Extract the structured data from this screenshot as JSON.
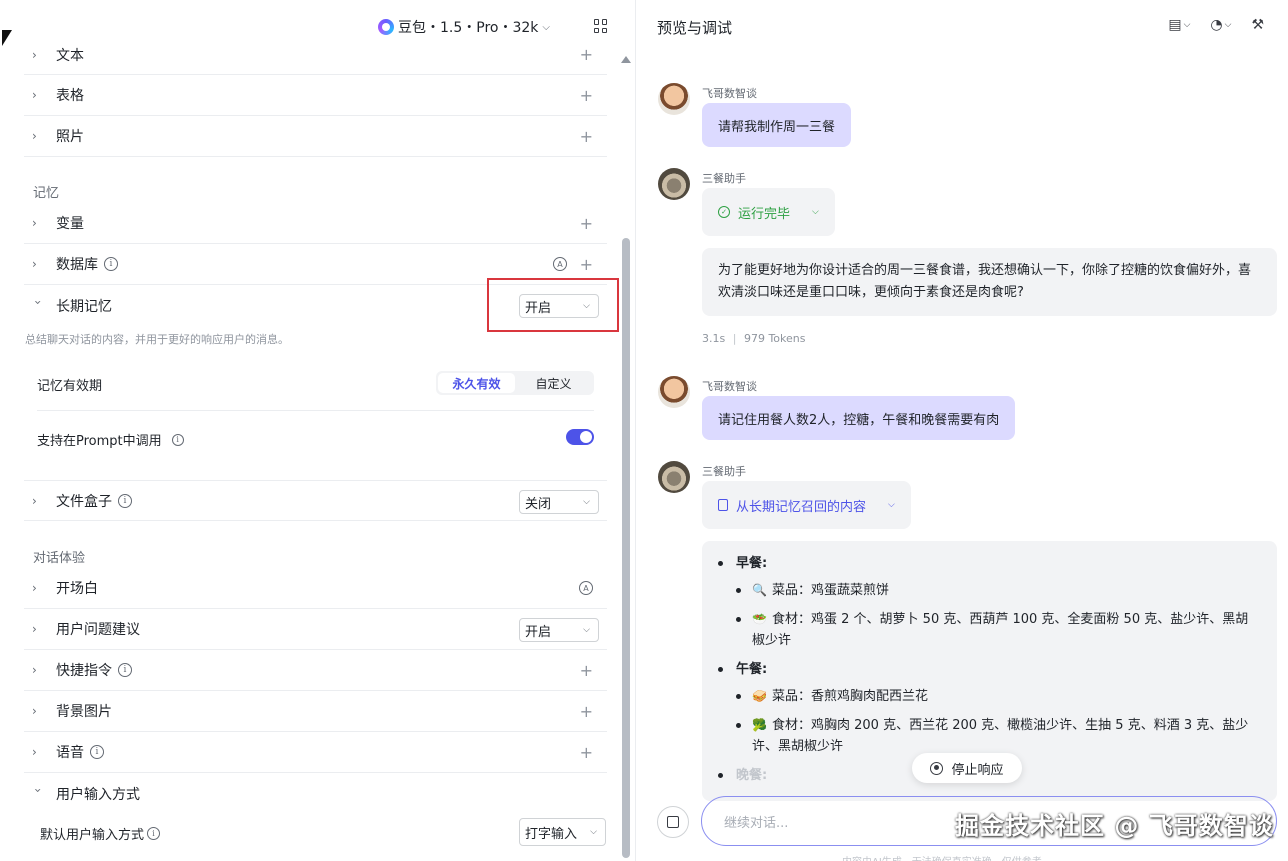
{
  "left": {
    "model": {
      "name": "豆包・1.5・Pro・32k"
    },
    "sections": [
      {
        "label": "文本"
      },
      {
        "label": "表格"
      },
      {
        "label": "照片"
      }
    ],
    "memory_title": "记忆",
    "memory_items": {
      "variables": "变量",
      "database": "数据库",
      "long_term": "长期记忆",
      "long_term_value": "开启",
      "long_term_desc": "总结聊天对话的内容，并用于更好的响应用户的消息。",
      "validity_label": "记忆有效期",
      "validity_options": [
        "永久有效",
        "自定义"
      ],
      "prompt_call_label": "支持在Prompt中调用",
      "file_box": "文件盒子",
      "file_box_value": "关闭"
    },
    "dialog_title": "对话体验",
    "dialog_items": {
      "opening": "开场白",
      "suggestions": "用户问题建议",
      "suggestions_value": "开启",
      "shortcuts": "快捷指令",
      "background": "背景图片",
      "voice": "语音",
      "input_method": "用户输入方式",
      "default_input_label": "默认用户输入方式",
      "default_input_value": "打字输入"
    }
  },
  "right": {
    "title": "预览与调试",
    "messages": {
      "user_name": "飞哥数智谈",
      "bot_name": "三餐助手",
      "user1": "请帮我制作周一三餐",
      "status1": "运行完毕",
      "bot1": "为了能更好地为你设计适合的周一三餐食谱，我还想确认一下，你除了控糖的饮食偏好外，喜欢清淡口味还是重口口味，更倾向于素食还是肉食呢?",
      "meta_time": "3.1s",
      "meta_tokens": "979 Tokens",
      "user2": "请记住用餐人数2人，控糖，午餐和晚餐需要有肉",
      "status2": "从长期记忆召回的内容",
      "breakfast": "早餐:",
      "b_dish": "菜品：鸡蛋蔬菜煎饼",
      "b_ing": "食材：鸡蛋 2 个、胡萝卜 50 克、西葫芦 100 克、全麦面粉 50 克、盐少许、黑胡椒少许",
      "lunch": "午餐:",
      "l_dish": "菜品：香煎鸡胸肉配西兰花",
      "l_ing": "食材：鸡胸肉 200 克、西兰花 200 克、橄榄油少许、生抽 5 克、料酒 3 克、盐少许、黑胡椒少许",
      "dinner": "晚餐:"
    },
    "stop_label": "停止响应",
    "input_placeholder": "继续对话...",
    "footnote": "内容由AI生成，无法确保真实准确，仅供参考",
    "watermark": "掘金技术社区 @ 飞哥数智谈"
  }
}
